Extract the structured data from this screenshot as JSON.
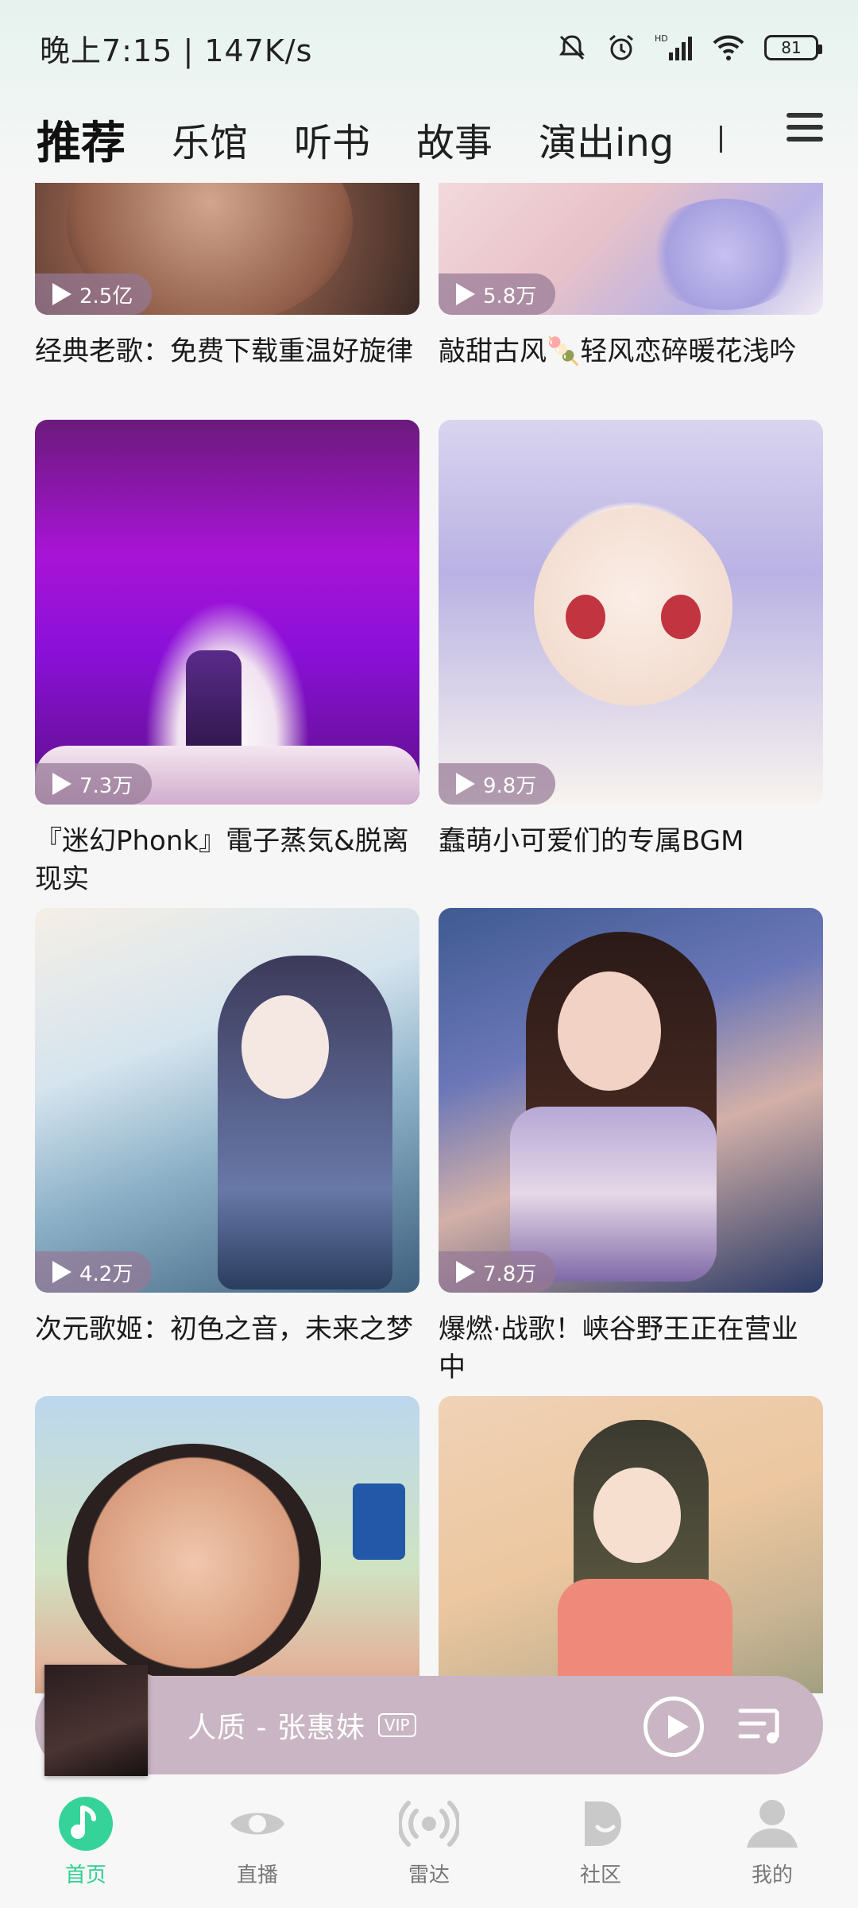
{
  "status": {
    "time": "晚上7:15",
    "network_speed": "147K/s",
    "battery": "81"
  },
  "tabs": [
    {
      "label": "推荐",
      "active": true
    },
    {
      "label": "乐馆"
    },
    {
      "label": "听书"
    },
    {
      "label": "故事"
    },
    {
      "label": "演出ing"
    }
  ],
  "cards": [
    {
      "plays": "2.5亿",
      "title": "经典老歌：免费下载重温好旋律"
    },
    {
      "plays": "5.8万",
      "title": "敲甜古风🍡轻风恋碎暖花浅吟"
    },
    {
      "plays": "7.3万",
      "title": "『迷幻Phonk』電子蒸気&脱离现实"
    },
    {
      "plays": "9.8万",
      "title": "蠢萌小可爱们的专属BGM"
    },
    {
      "plays": "4.2万",
      "title": "次元歌姬：初色之音，未来之梦"
    },
    {
      "plays": "7.8万",
      "title": "爆燃·战歌！峡谷野王正在营业中"
    },
    {
      "plays": "",
      "title": ""
    },
    {
      "plays": "",
      "title": ""
    }
  ],
  "player": {
    "song": "人质 - 张惠妹",
    "vip": "VIP"
  },
  "nav": [
    {
      "label": "首页",
      "icon": "music-note-icon",
      "active": true
    },
    {
      "label": "直播",
      "icon": "eye-icon"
    },
    {
      "label": "雷达",
      "icon": "radar-icon"
    },
    {
      "label": "社区",
      "icon": "community-icon"
    },
    {
      "label": "我的",
      "icon": "profile-icon"
    }
  ],
  "colors": {
    "accent": "#35d39a",
    "player_bg": "#c9b5c3"
  }
}
